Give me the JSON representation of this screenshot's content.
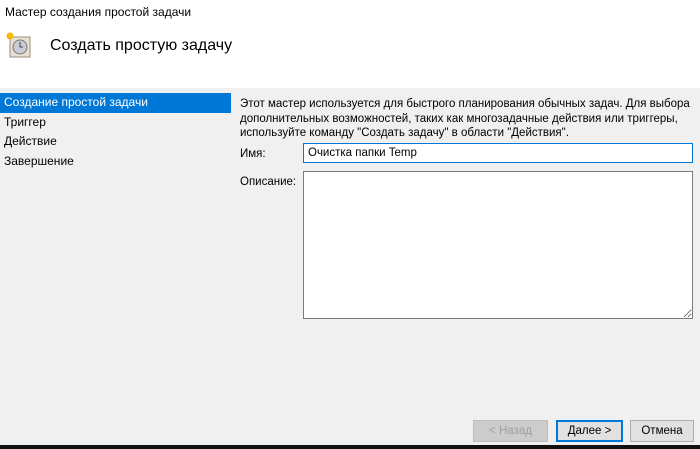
{
  "window": {
    "title": "Мастер создания простой задачи"
  },
  "header": {
    "title": "Создать простую задачу",
    "icon": "task-scheduler-clock-icon"
  },
  "sidebar": {
    "items": [
      {
        "label": "Создание простой задачи",
        "selected": true
      },
      {
        "label": "Триггер"
      },
      {
        "label": "Действие"
      },
      {
        "label": "Завершение"
      }
    ]
  },
  "main": {
    "description": "Этот мастер используется для быстрого планирования обычных задач.  Для выбора дополнительных возможностей, таких как многозадачные действия или триггеры, используйте команду \"Создать задачу\" в области \"Действия\".",
    "name_label": "Имя:",
    "name_value": "Очистка папки Temp",
    "desc_label": "Описание:",
    "desc_value": ""
  },
  "buttons": {
    "back": "< Назад",
    "next": "Далее >",
    "cancel": "Отмена"
  },
  "colors": {
    "accent": "#0078d7"
  }
}
